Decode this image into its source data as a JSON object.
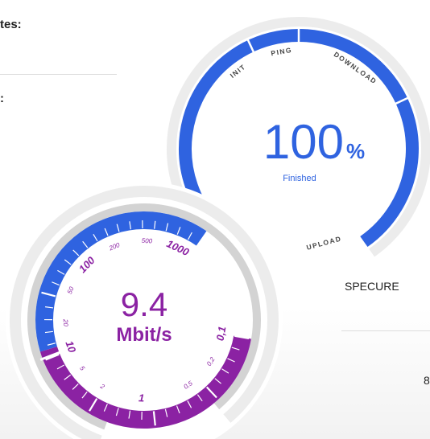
{
  "left_panel": {
    "label_top": "tes:",
    "label_mid": ":"
  },
  "right_panel": {
    "server_name": "SPECURE",
    "partial_text": "8"
  },
  "progress": {
    "percent_value": "100",
    "percent_sign": "%",
    "status": "Finished",
    "fraction": 1.0,
    "phases": [
      "INIT",
      "PING",
      "DOWNLOAD",
      "UPLOAD"
    ]
  },
  "speed": {
    "value": "9.4",
    "unit": "Mbit/s",
    "scale_upload": [
      "0,1",
      "0,2",
      "0,5",
      "1",
      "2",
      "5",
      "10"
    ],
    "scale_download": [
      "20",
      "50",
      "100",
      "200",
      "500",
      "1000"
    ]
  },
  "colors": {
    "blue": "#2f63e0",
    "purple": "#8b22a3",
    "ring_gray": "#d3d3d3",
    "ring_light": "#ececec"
  }
}
